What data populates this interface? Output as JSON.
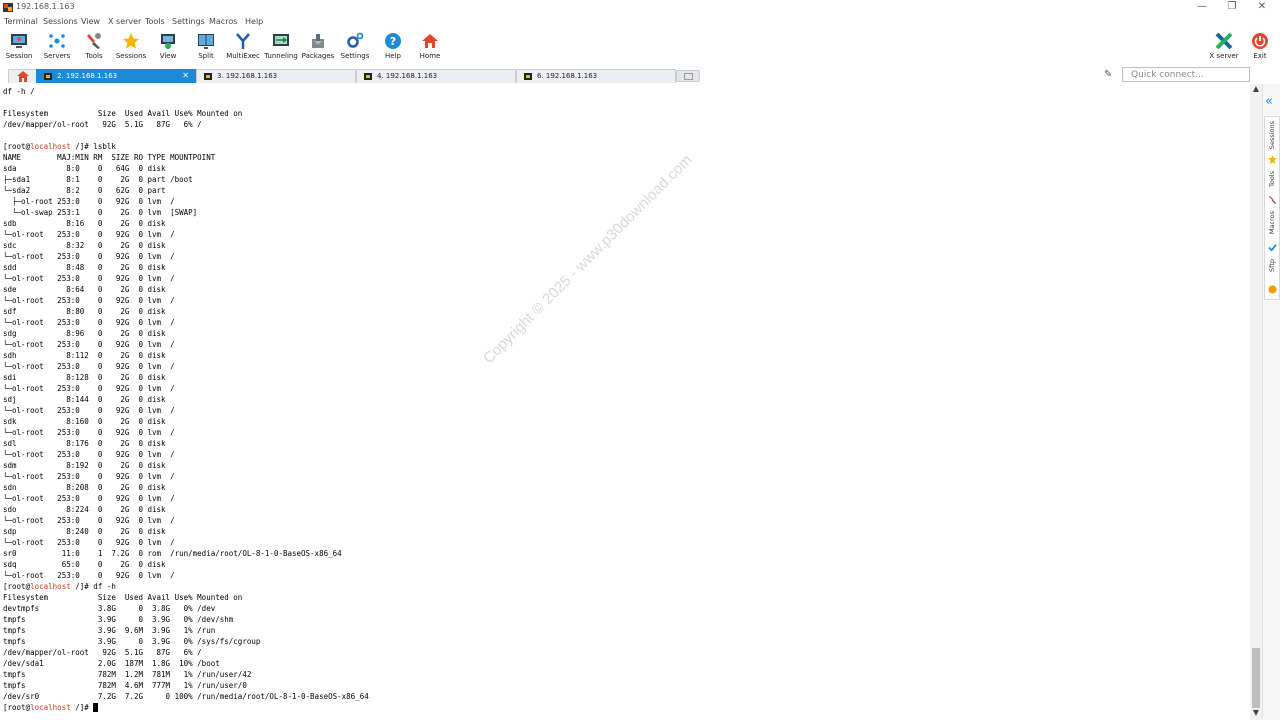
{
  "window": {
    "title": "192.168.1.163",
    "minimize": "—",
    "restore": "❐",
    "close": "✕"
  },
  "menu": [
    "Terminal",
    "Sessions",
    "View",
    "X server",
    "Tools",
    "Settings",
    "Macros",
    "Help"
  ],
  "toolbar": {
    "buttons": [
      {
        "label": "Session",
        "icon": "session-icon"
      },
      {
        "label": "Servers",
        "icon": "servers-icon"
      },
      {
        "label": "Tools",
        "icon": "tools-icon"
      },
      {
        "label": "Sessions",
        "icon": "star-icon"
      },
      {
        "label": "View",
        "icon": "view-icon"
      },
      {
        "label": "Split",
        "icon": "split-icon"
      },
      {
        "label": "MultiExec",
        "icon": "multiexec-icon"
      },
      {
        "label": "Tunneling",
        "icon": "tunneling-icon"
      },
      {
        "label": "Packages",
        "icon": "packages-icon"
      },
      {
        "label": "Settings",
        "icon": "settings-icon"
      },
      {
        "label": "Help",
        "icon": "help-icon"
      },
      {
        "label": "Home",
        "icon": "home-icon"
      }
    ],
    "xserver": "X server",
    "exit": "Exit"
  },
  "tabs": [
    {
      "label": "2. 192.168.1.163",
      "active": true,
      "close": "✕"
    },
    {
      "label": "3. 192.168.1.163",
      "active": false
    },
    {
      "label": "4. 192.168.1.163",
      "active": false
    },
    {
      "label": "6. 192.168.1.163",
      "active": false
    }
  ],
  "quick_connect": {
    "placeholder": "Quick connect..."
  },
  "terminal": {
    "lines": [
      {
        "text": "df -h /"
      },
      {
        "text": ""
      },
      {
        "text": "Filesystem           Size  Used Avail Use% Mounted on"
      },
      {
        "text": "/dev/mapper/ol-root   92G  5.1G   87G   6% /"
      },
      {
        "text": ""
      },
      {
        "prefix": "[root@",
        "host": "localhost",
        "suffix": " /]# lsblk"
      },
      {
        "text": "NAME        MAJ:MIN RM  SIZE RO TYPE MOUNTPOINT"
      },
      {
        "text": "sda           8:0    0   64G  0 disk"
      },
      {
        "text": "├─sda1        8:1    0    2G  0 part /boot"
      },
      {
        "text": "└─sda2        8:2    0   62G  0 part"
      },
      {
        "text": "  ├─ol-root 253:0    0   92G  0 lvm  /"
      },
      {
        "text": "  └─ol-swap 253:1    0    2G  0 lvm  [SWAP]"
      },
      {
        "text": "sdb           8:16   0    2G  0 disk"
      },
      {
        "text": "└─ol-root   253:0    0   92G  0 lvm  /"
      },
      {
        "text": "sdc           8:32   0    2G  0 disk"
      },
      {
        "text": "└─ol-root   253:0    0   92G  0 lvm  /"
      },
      {
        "text": "sdd           8:48   0    2G  0 disk"
      },
      {
        "text": "└─ol-root   253:0    0   92G  0 lvm  /"
      },
      {
        "text": "sde           8:64   0    2G  0 disk"
      },
      {
        "text": "└─ol-root   253:0    0   92G  0 lvm  /"
      },
      {
        "text": "sdf           8:80   0    2G  0 disk"
      },
      {
        "text": "└─ol-root   253:0    0   92G  0 lvm  /"
      },
      {
        "text": "sdg           8:96   0    2G  0 disk"
      },
      {
        "text": "└─ol-root   253:0    0   92G  0 lvm  /"
      },
      {
        "text": "sdh           8:112  0    2G  0 disk"
      },
      {
        "text": "└─ol-root   253:0    0   92G  0 lvm  /"
      },
      {
        "text": "sdi           8:128  0    2G  0 disk"
      },
      {
        "text": "└─ol-root   253:0    0   92G  0 lvm  /"
      },
      {
        "text": "sdj           8:144  0    2G  0 disk"
      },
      {
        "text": "└─ol-root   253:0    0   92G  0 lvm  /"
      },
      {
        "text": "sdk           8:160  0    2G  0 disk"
      },
      {
        "text": "└─ol-root   253:0    0   92G  0 lvm  /"
      },
      {
        "text": "sdl           8:176  0    2G  0 disk"
      },
      {
        "text": "└─ol-root   253:0    0   92G  0 lvm  /"
      },
      {
        "text": "sdm           8:192  0    2G  0 disk"
      },
      {
        "text": "└─ol-root   253:0    0   92G  0 lvm  /"
      },
      {
        "text": "sdn           8:208  0    2G  0 disk"
      },
      {
        "text": "└─ol-root   253:0    0   92G  0 lvm  /"
      },
      {
        "text": "sdo           8:224  0    2G  0 disk"
      },
      {
        "text": "└─ol-root   253:0    0   92G  0 lvm  /"
      },
      {
        "text": "sdp           8:240  0    2G  0 disk"
      },
      {
        "text": "└─ol-root   253:0    0   92G  0 lvm  /"
      },
      {
        "text": "sr0          11:0    1  7.2G  0 rom  /run/media/root/OL-8-1-0-BaseOS-x86_64"
      },
      {
        "text": "sdq          65:0    0    2G  0 disk"
      },
      {
        "text": "└─ol-root   253:0    0   92G  0 lvm  /"
      },
      {
        "prefix": "[root@",
        "host": "localhost",
        "suffix": " /]# df -h"
      },
      {
        "text": "Filesystem           Size  Used Avail Use% Mounted on"
      },
      {
        "text": "devtmpfs             3.8G     0  3.8G   0% /dev"
      },
      {
        "text": "tmpfs                3.9G     0  3.9G   0% /dev/shm"
      },
      {
        "text": "tmpfs                3.9G  9.6M  3.9G   1% /run"
      },
      {
        "text": "tmpfs                3.9G     0  3.9G   0% /sys/fs/cgroup"
      },
      {
        "text": "/dev/mapper/ol-root   92G  5.1G   87G   6% /"
      },
      {
        "text": "/dev/sda1            2.0G  187M  1.8G  10% /boot"
      },
      {
        "text": "tmpfs                782M  1.2M  781M   1% /run/user/42"
      },
      {
        "text": "tmpfs                782M  4.6M  777M   1% /run/user/0"
      },
      {
        "text": "/dev/sr0             7.2G  7.2G     0 100% /run/media/root/OL-8-1-0-BaseOS-x86_64"
      },
      {
        "prefix": "[root@",
        "host": "localhost",
        "suffix": " /]# ",
        "cursor": true
      }
    ]
  },
  "watermark": "Copyright © 2025 - www.p30download.com",
  "sidebar": {
    "collapse": "«",
    "tabs": [
      {
        "label": "Sessions",
        "icon": "star-icon",
        "color": "#f5b400"
      },
      {
        "label": "Tools",
        "icon": "tools-icon",
        "color": "#e2462e"
      },
      {
        "label": "Macros",
        "icon": "macros-icon",
        "color": "#1e8ad6"
      },
      {
        "label": "Sftp",
        "icon": "sftp-icon",
        "color": "#f59a00"
      }
    ]
  },
  "scroll": {
    "up": "▲",
    "down": "▼"
  },
  "colors": {
    "accent": "#1e8ad6",
    "host": "#c0392b"
  }
}
